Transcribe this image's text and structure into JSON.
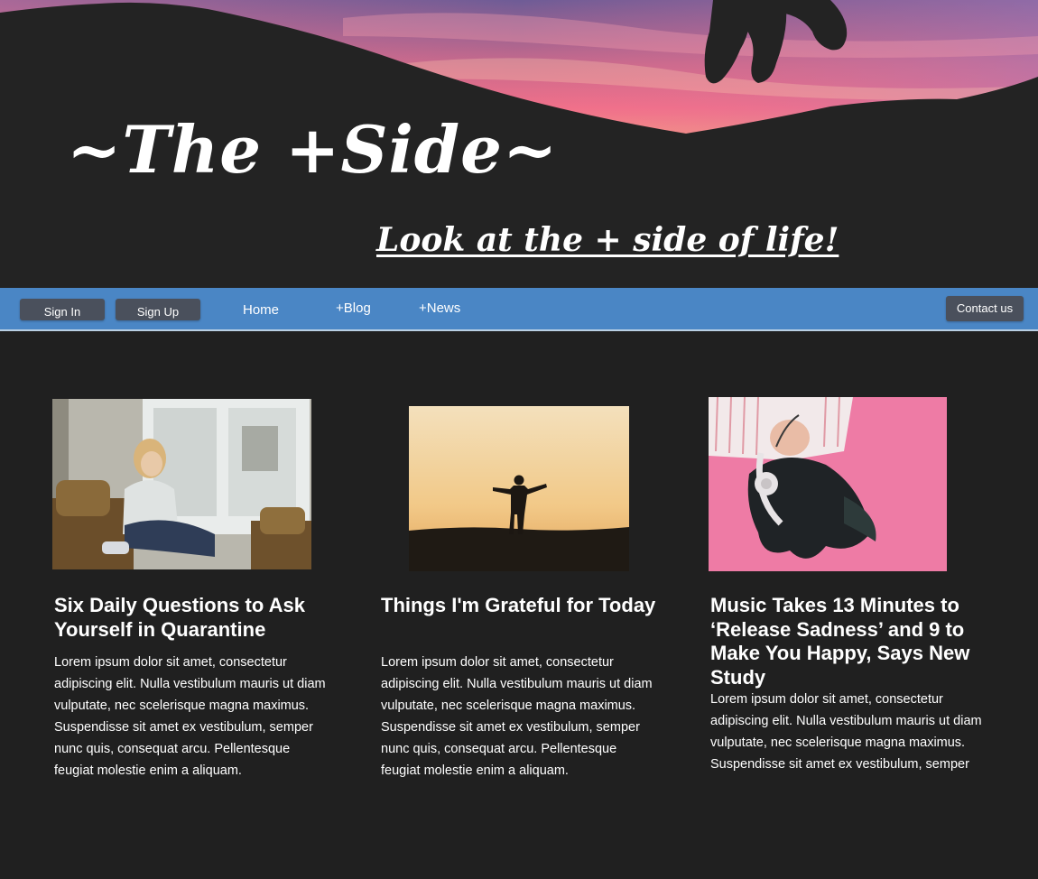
{
  "hero": {
    "title": "~The +Side~",
    "tagline": "Look at the + side of life!"
  },
  "nav": {
    "sign_in": "Sign In",
    "sign_up": "Sign Up",
    "home": "Home",
    "blog": "+Blog",
    "news": "+News",
    "contact": "Contact us"
  },
  "articles": [
    {
      "title": "Six Daily Questions to Ask Yourself in Quarantine",
      "body": "Lorem ipsum dolor sit amet, consectetur adipiscing elit. Nulla vestibulum mauris ut diam vulputate, nec scelerisque magna maximus. Suspendisse sit amet ex vestibulum, semper nunc quis, consequat arcu. Pellentesque feugiat molestie enim a aliquam."
    },
    {
      "title": "Things I'm Grateful for Today",
      "body": "Lorem ipsum dolor sit amet, consectetur adipiscing elit. Nulla vestibulum mauris ut diam vulputate, nec scelerisque magna maximus. Suspendisse sit amet ex vestibulum, semper nunc quis, consequat arcu. Pellentesque feugiat molestie enim a aliquam."
    },
    {
      "title": "Music Takes 13 Minutes to ‘Release Sadness’ and 9 to Make You Happy, Says New Study",
      "body": "Lorem ipsum dolor sit amet, consectetur adipiscing elit. Nulla vestibulum mauris ut diam vulputate, nec scelerisque magna maximus. Suspendisse sit amet ex vestibulum, semper"
    }
  ],
  "colors": {
    "background": "#202020",
    "nav_bar": "#4a86c5",
    "button": "#4a505c",
    "sunset_pink": "#e8627a",
    "sunset_purple": "#7a5a9a",
    "card3_pink": "#ee7ba5"
  }
}
